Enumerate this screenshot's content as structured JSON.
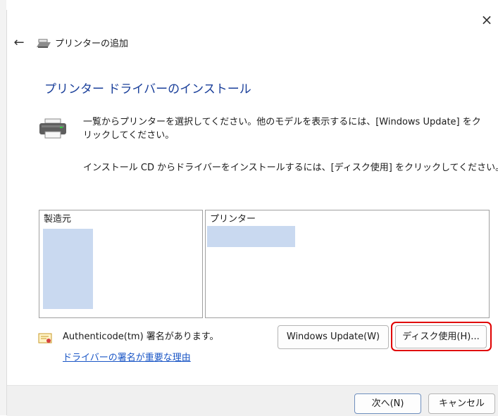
{
  "window": {
    "title": "プリンターの追加",
    "close_glyph": "×",
    "back_glyph": "←"
  },
  "page": {
    "heading": "プリンター ドライバーのインストール",
    "description_1": "一覧からプリンターを選択してください。他のモデルを表示するには、[Windows Update] をクリックしてください。",
    "description_2": "インストール CD からドライバーをインストールするには、[ディスク使用] をクリックしてください。"
  },
  "manufacturer_list": {
    "header": "製造元",
    "items": []
  },
  "printer_list": {
    "header": "プリンター",
    "items": []
  },
  "signature": {
    "text": "Authenticode(tm) 署名があります。",
    "link": "ドライバーの署名が重要な理由"
  },
  "buttons": {
    "windows_update": "Windows Update(W)",
    "have_disk": "ディスク使用(H)...",
    "next": "次へ(N)",
    "cancel": "キャンセル"
  },
  "colors": {
    "heading": "#1a3f9a",
    "link": "#1a56c6",
    "highlight": "#e00000",
    "selection": "#c9d9f0"
  },
  "icons": {
    "title": "printer-icon",
    "description": "printer-icon",
    "signature": "certificate-icon"
  }
}
